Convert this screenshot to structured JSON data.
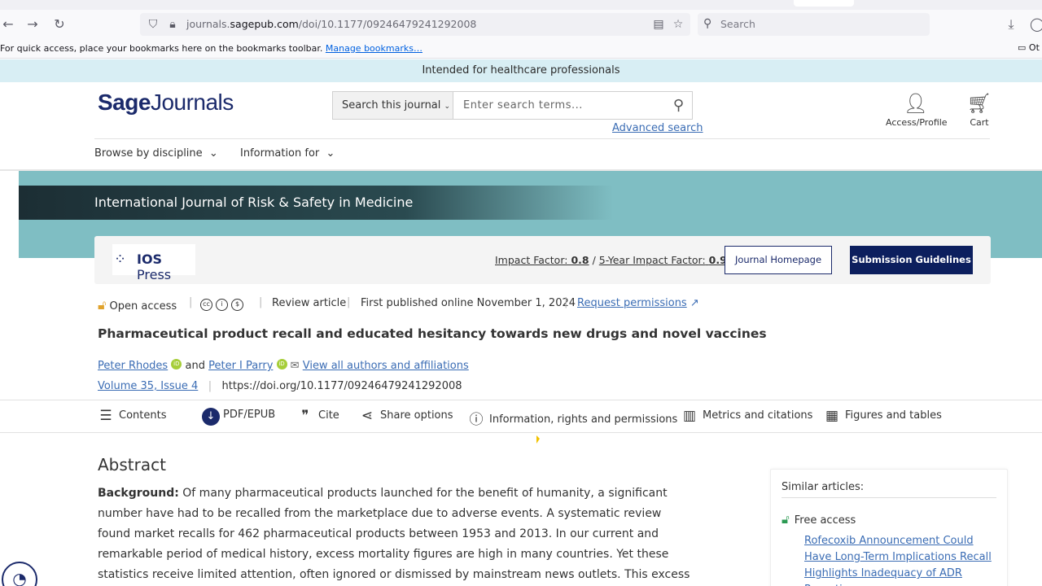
{
  "browser": {
    "url_prefix": "journals.",
    "url_domain": "sagepub.com",
    "url_path": "/doi/10.1177/09246479241292008",
    "search_placeholder": "Search",
    "bookmarks_message": "For quick access, place your bookmarks here on the bookmarks toolbar.",
    "manage_bookmarks": "Manage bookmarks…",
    "other_bookmarks": "Ot"
  },
  "site": {
    "banner": "Intended for healthcare professionals",
    "logo_bold": "Sage",
    "logo_regular": "Journals",
    "search_scope": "Search this journal",
    "search_placeholder": "Enter search terms...",
    "advanced_search": "Advanced search",
    "account_label": "Access/Profile",
    "cart_label": "Cart",
    "nav": [
      "Browse by discipline",
      "Information for"
    ]
  },
  "journal": {
    "title": "International Journal of Risk & Safety in Medicine",
    "publisher_bold": "IOS",
    "publisher_regular": "Press",
    "impact_factor_label": "Impact Factor:",
    "impact_factor": "0.8",
    "five_year_label": "5-Year Impact Factor:",
    "five_year": "0.9",
    "homepage_button": "Journal Homepage",
    "submission_button": "Submission Guidelines"
  },
  "article": {
    "access": "Open access",
    "type": "Review article",
    "published": "First published online November 1, 2024",
    "permissions": "Request permissions",
    "title": "Pharmaceutical product recall and educated hesitancy towards new drugs and novel vaccines",
    "author1": "Peter Rhodes",
    "and": "and",
    "author2": "Peter I Parry",
    "all_authors": "View all authors and affiliations",
    "volume": "Volume 35, Issue 4",
    "doi": "https://doi.org/10.1177/09246479241292008"
  },
  "toolbar": {
    "contents": "Contents",
    "pdf": "PDF/EPUB",
    "cite": "Cite",
    "share": "Share options",
    "info": "Information, rights and permissions",
    "metrics": "Metrics and citations",
    "figures": "Figures and tables"
  },
  "abstract": {
    "heading": "Abstract",
    "label": "Background:",
    "text": " Of many pharmaceutical products launched for the benefit of humanity, a significant number have had to be recalled from the marketplace due to adverse events. A systematic review found market recalls for 462 pharmaceutical products between 1953 and 2013. In our current and remarkable period of medical history, excess mortality figures are high in many countries. Yet these statistics receive limited attention, often ignored or dismissed by mainstream news outlets. This excess mortality may include"
  },
  "similar": {
    "heading": "Similar articles:",
    "free_access": "Free access",
    "article_title": "Rofecoxib Announcement Could Have Long-Term Implications Recall Highlights Inadequacy of ADR Reporting"
  }
}
